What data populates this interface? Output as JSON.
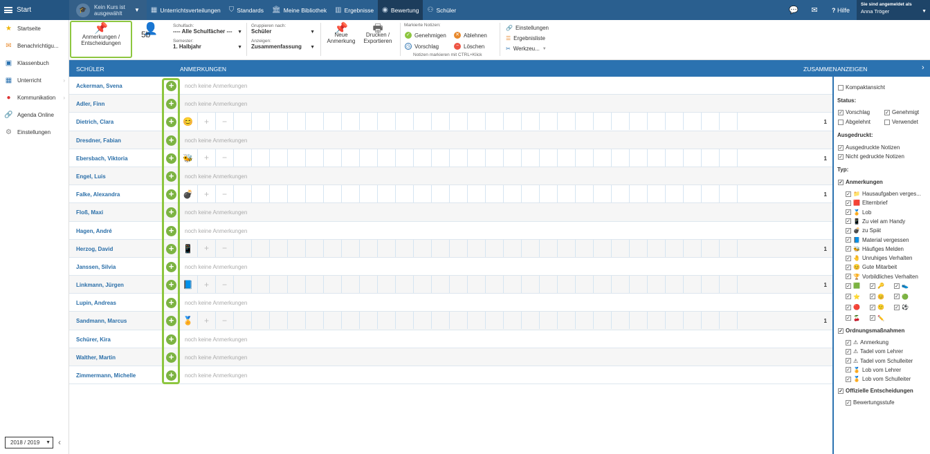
{
  "topbar": {
    "start": "Start",
    "course_line1": "Kein Kurs ist",
    "course_line2": "ausgewählt",
    "nav": [
      {
        "label": "Unterrichtsverteilungen",
        "icon": "calendar-icon"
      },
      {
        "label": "Standards",
        "icon": "shield-icon"
      },
      {
        "label": "Meine Bibliothek",
        "icon": "library-icon"
      },
      {
        "label": "Ergebnisse",
        "icon": "bar-chart-icon"
      },
      {
        "label": "Bewertung",
        "icon": "grade-icon"
      },
      {
        "label": "Schüler",
        "icon": "students-icon"
      }
    ],
    "help": "Hilfe",
    "user_label": "Sie sind angemeldet als",
    "user_name": "Anna Tröger"
  },
  "sidebar": {
    "items": [
      "Startseite",
      "Benachrichtigu...",
      "Klassenbuch",
      "Unterricht",
      "Kommunikation",
      "Agenda Online",
      "Einstellungen"
    ],
    "year": "2018 / 2019"
  },
  "toolbar": {
    "notes_button": "Anmerkungen / Entscheidungen",
    "notes_line1": "Anmerkungen /",
    "notes_line2": "Entscheidungen",
    "class": "5b",
    "subject_label": "Schulfach:",
    "subject_value": "---- Alle Schulfächer ---",
    "semester_label": "Semester:",
    "semester_value": "1. Halbjahr",
    "group_label": "Gruppieren nach:",
    "group_value": "Schüler",
    "show_label": "Anzeigen:",
    "show_value": "Zusammenfassung",
    "new_line1": "Neue",
    "new_line2": "Anmerkung",
    "print_line1": "Drucken /",
    "print_line2": "Exportieren",
    "marked_label": "Markierte Notizen:",
    "approve": "Genehmigen",
    "reject": "Ablehnen",
    "suggest": "Vorschlag",
    "delete": "Löschen",
    "hint": "Notizen markieren mit CTRL+Klick",
    "settings": "Einstellungen",
    "results_list": "Ergebnisliste",
    "tools": "Werkzeu..."
  },
  "header": {
    "student": "Schüler",
    "notes": "Anmerkungen",
    "summary": "Zusammen",
    "show": "Anzeigen"
  },
  "no_notes": "noch keine Anmerkungen",
  "students": [
    {
      "name": "Ackerman, Svena",
      "emoji": "",
      "count": ""
    },
    {
      "name": "Adler, Finn",
      "emoji": "",
      "count": ""
    },
    {
      "name": "Dietrich, Clara",
      "emoji": "😊",
      "count": "1"
    },
    {
      "name": "Dresdner, Fabian",
      "emoji": "",
      "count": ""
    },
    {
      "name": "Ebersbach, Viktoria",
      "emoji": "🐝",
      "count": "1"
    },
    {
      "name": "Engel, Luis",
      "emoji": "",
      "count": ""
    },
    {
      "name": "Falke, Alexandra",
      "emoji": "💣",
      "count": "1"
    },
    {
      "name": "Floß, Maxi",
      "emoji": "",
      "count": ""
    },
    {
      "name": "Hagen, André",
      "emoji": "",
      "count": ""
    },
    {
      "name": "Herzog, David",
      "emoji": "📱",
      "count": "1"
    },
    {
      "name": "Janssen, Silvia",
      "emoji": "",
      "count": ""
    },
    {
      "name": "Linkmann, Jürgen",
      "emoji": "📘",
      "count": "1"
    },
    {
      "name": "Lupin, Andreas",
      "emoji": "",
      "count": ""
    },
    {
      "name": "Sandmann, Marcus",
      "emoji": "🏅",
      "count": "1"
    },
    {
      "name": "Schürer, Kira",
      "emoji": "",
      "count": ""
    },
    {
      "name": "Walther, Martin",
      "emoji": "",
      "count": ""
    },
    {
      "name": "Zimmermann, Michelle",
      "emoji": "",
      "count": ""
    }
  ],
  "panel": {
    "compact": "Kompaktansicht",
    "status": "Status:",
    "suggestion": "Vorschlag",
    "approved": "Genehmigt",
    "rejected": "Abgelehnt",
    "used": "Verwendet",
    "printed": "Ausgedruckt:",
    "printed_yes": "Ausgedruckte Notizen",
    "printed_no": "Nicht gedruckte Notizen",
    "type": "Typ:",
    "notes": "Anmerkungen",
    "note_types": [
      "Hausaufgaben verges...",
      "Elternbrief",
      "Lob",
      "Zu viel am Handy",
      "zu Spät",
      "Material vergessen",
      "Häufiges Melden",
      "Unruhiges Verhalten",
      "Gute Mitarbeit",
      "Vorbildliches Verhalten"
    ],
    "note_icons": [
      "📁",
      "🟥",
      "🏅",
      "📱",
      "💣",
      "📘",
      "🐝",
      "🤚",
      "😊",
      "🏆"
    ],
    "grid_icons": [
      "🟩",
      "🔑",
      "👟",
      "⭐",
      "😊",
      "🟢",
      "🔴",
      "🙂",
      "⚽",
      "🍒",
      "✏️"
    ],
    "discipline": "Ordnungsmaßnahmen",
    "discipline_items": [
      "Anmerkung",
      "Tadel vom Lehrer",
      "Tadel vom Schulleiter",
      "Lob vom Lehrer",
      "Lob vom Schulleiter"
    ],
    "discipline_icons": [
      "⚠",
      "⚠",
      "⚠",
      "🏅",
      "🏅"
    ],
    "official": "Offizielle Entscheidungen",
    "official_items": [
      "Bewertungsstufe"
    ]
  }
}
